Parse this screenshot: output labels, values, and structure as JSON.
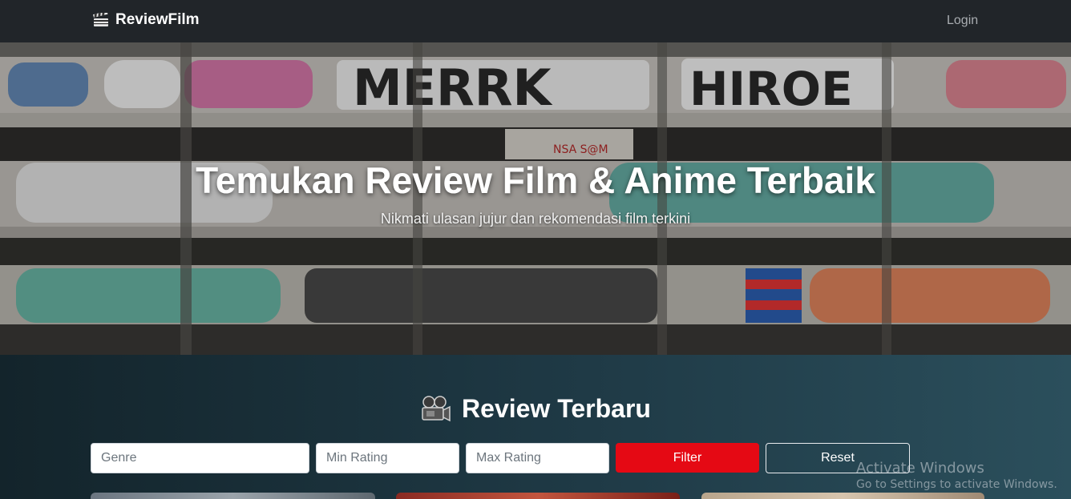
{
  "navbar": {
    "brand": "ReviewFilm",
    "brand_icon": "clapperboard-icon",
    "login_label": "Login"
  },
  "hero": {
    "title": "Temukan Review Film & Anime Terbaik",
    "subtitle": "Nikmati ulasan jujur dan rekomendasi film terkini"
  },
  "reviews": {
    "title": "Review Terbaru",
    "title_icon": "movie-camera-icon",
    "filters": {
      "genre_placeholder": "Genre",
      "min_rating_placeholder": "Min Rating",
      "max_rating_placeholder": "Max Rating",
      "filter_label": "Filter",
      "reset_label": "Reset"
    }
  },
  "watermark": {
    "line1": "Activate Windows",
    "line2": "Go to Settings to activate Windows."
  },
  "colors": {
    "navbar": "#212529",
    "accent": "#e50914"
  }
}
